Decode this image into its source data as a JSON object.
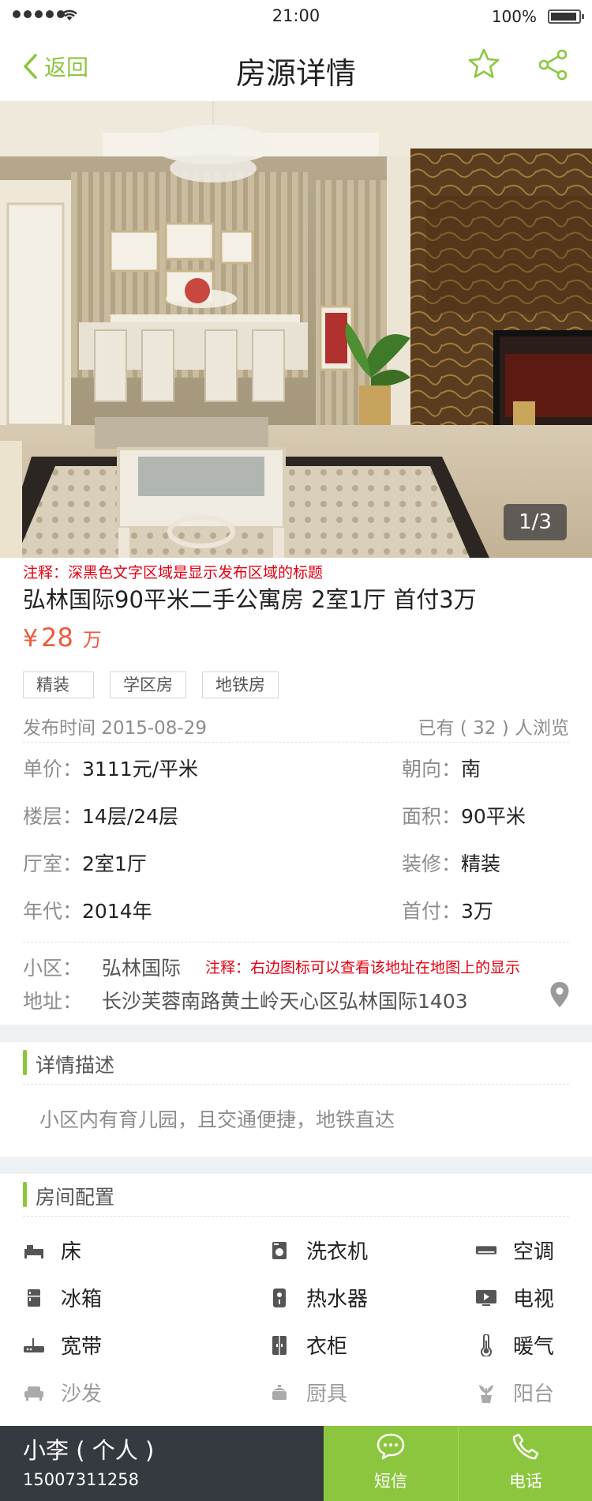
{
  "status_bar": {
    "time": "21:00",
    "battery": "100%"
  },
  "nav": {
    "back_label": "返回",
    "title": "房源详情"
  },
  "gallery": {
    "counter": "1/3"
  },
  "listing": {
    "note": "注释：深黑色文字区域是显示发布区域的标题",
    "title": "弘林国际90平米二手公寓房  2室1厅 首付3万",
    "price_currency": "¥",
    "price_value": "28",
    "price_unit": "万",
    "tags": [
      "精装",
      "学区房",
      "地铁房"
    ],
    "publish_time": "发布时间 2015-08-29",
    "views": "已有 ( 32 ) 人浏览",
    "attributes": [
      {
        "key": "单价：",
        "value": "3111元/平米"
      },
      {
        "key": "朝向：",
        "value": "南"
      },
      {
        "key": "楼层：",
        "value": "14层/24层"
      },
      {
        "key": "面积：",
        "value": "90平米"
      },
      {
        "key": "厅室：",
        "value": "2室1厅"
      },
      {
        "key": "装修：",
        "value": "精装"
      },
      {
        "key": "年代：",
        "value": "2014年"
      },
      {
        "key": "首付：",
        "value": "3万"
      }
    ],
    "community_key": "小区：",
    "community_value": "弘林国际",
    "map_note": "注释：右边图标可以查看该地址在地图上的显示",
    "address_key": "地址：",
    "address_value": "长沙芙蓉南路黄土岭天心区弘林国际1403"
  },
  "description": {
    "title": "详情描述",
    "text": "小区内有育儿园，且交通便捷，地铁直达"
  },
  "amenities": {
    "title": "房间配置",
    "items": [
      {
        "label": "床",
        "icon": "bed-icon",
        "available": true
      },
      {
        "label": "洗衣机",
        "icon": "washing-machine-icon",
        "available": true
      },
      {
        "label": "空调",
        "icon": "air-conditioner-icon",
        "available": true
      },
      {
        "label": "冰箱",
        "icon": "fridge-icon",
        "available": true
      },
      {
        "label": "热水器",
        "icon": "water-heater-icon",
        "available": true
      },
      {
        "label": "电视",
        "icon": "tv-icon",
        "available": true
      },
      {
        "label": "宽带",
        "icon": "router-icon",
        "available": true
      },
      {
        "label": "衣柜",
        "icon": "wardrobe-icon",
        "available": true
      },
      {
        "label": "暖气",
        "icon": "thermometer-icon",
        "available": true
      },
      {
        "label": "沙发",
        "icon": "sofa-icon",
        "available": false
      },
      {
        "label": "厨具",
        "icon": "cookware-icon",
        "available": false
      },
      {
        "label": "阳台",
        "icon": "plant-icon",
        "available": false
      }
    ]
  },
  "footer": {
    "contact_name": "小李 ( 个人 )",
    "contact_phone": "15007311258",
    "sms_label": "短信",
    "call_label": "电话"
  },
  "colors": {
    "accent": "#8cc63f",
    "price": "#ee5a3c",
    "note": "#e60012",
    "footer_dark": "#353a40"
  }
}
